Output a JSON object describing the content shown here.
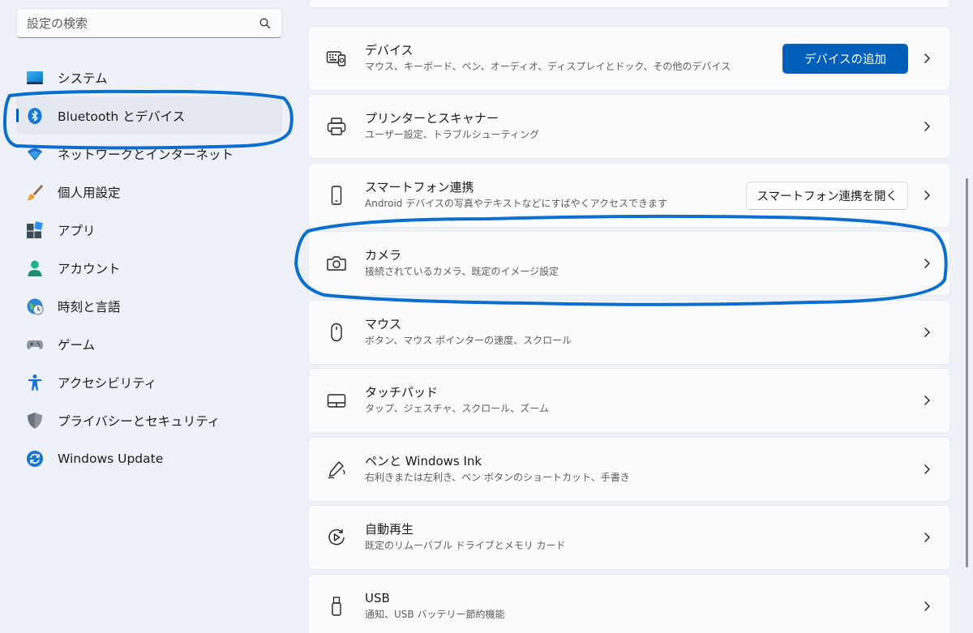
{
  "search": {
    "placeholder": "設定の検索"
  },
  "sidebar": {
    "items": [
      {
        "label": "システム",
        "icon": "system-icon"
      },
      {
        "label": "Bluetooth とデバイス",
        "icon": "bluetooth-icon",
        "selected": true
      },
      {
        "label": "ネットワークとインターネット",
        "icon": "network-icon"
      },
      {
        "label": "個人用設定",
        "icon": "personalization-icon"
      },
      {
        "label": "アプリ",
        "icon": "apps-icon"
      },
      {
        "label": "アカウント",
        "icon": "account-icon"
      },
      {
        "label": "時刻と言語",
        "icon": "time-language-icon"
      },
      {
        "label": "ゲーム",
        "icon": "gaming-icon"
      },
      {
        "label": "アクセシビリティ",
        "icon": "accessibility-icon"
      },
      {
        "label": "プライバシーとセキュリティ",
        "icon": "privacy-shield-icon"
      },
      {
        "label": "Windows Update",
        "icon": "windows-update-icon"
      }
    ]
  },
  "main": {
    "cards": [
      {
        "title": "デバイス",
        "subtitle": "マウス、キーボード、ペン、オーディオ、ディスプレイとドック、その他のデバイス",
        "icon": "devices-icon",
        "button": "デバイスの追加"
      },
      {
        "title": "プリンターとスキャナー",
        "subtitle": "ユーザー設定、トラブルシューティング",
        "icon": "printer-icon"
      },
      {
        "title": "スマートフォン連携",
        "subtitle": "Android デバイスの写真やテキストなどにすばやくアクセスできます",
        "icon": "phone-icon",
        "button": "スマートフォン連携を開く"
      },
      {
        "title": "カメラ",
        "subtitle": "接続されているカメラ、既定のイメージ設定",
        "icon": "camera-icon"
      },
      {
        "title": "マウス",
        "subtitle": "ボタン、マウス ポインターの速度、スクロール",
        "icon": "mouse-icon"
      },
      {
        "title": "タッチパッド",
        "subtitle": "タップ、ジェスチャ、スクロール、ズーム",
        "icon": "touchpad-icon"
      },
      {
        "title": "ペンと Windows Ink",
        "subtitle": "右利きまたは左利き、ペン ボタンのショートカット、手書き",
        "icon": "pen-icon"
      },
      {
        "title": "自動再生",
        "subtitle": "既定のリムーバブル ドライブとメモリ カード",
        "icon": "autoplay-icon"
      },
      {
        "title": "USB",
        "subtitle": "通知、USB バッテリー節約機能",
        "icon": "usb-icon"
      }
    ]
  },
  "colors": {
    "accent": "#005fb8",
    "annotation": "#0a6fd0",
    "background": "#eef2f8"
  }
}
